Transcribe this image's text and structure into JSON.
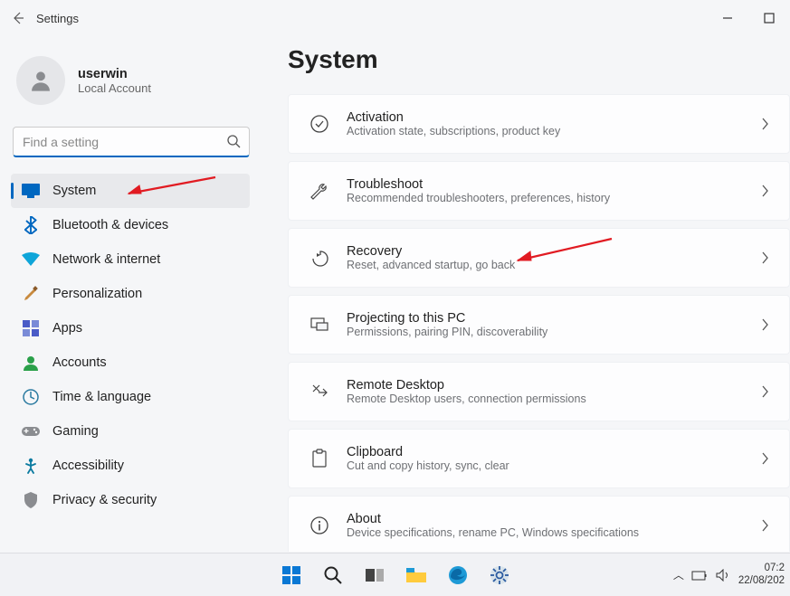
{
  "titlebar": {
    "title": "Settings"
  },
  "account": {
    "name": "userwin",
    "sub": "Local Account"
  },
  "search": {
    "placeholder": "Find a setting"
  },
  "sidebar": {
    "items": [
      {
        "label": "System"
      },
      {
        "label": "Bluetooth & devices"
      },
      {
        "label": "Network & internet"
      },
      {
        "label": "Personalization"
      },
      {
        "label": "Apps"
      },
      {
        "label": "Accounts"
      },
      {
        "label": "Time & language"
      },
      {
        "label": "Gaming"
      },
      {
        "label": "Accessibility"
      },
      {
        "label": "Privacy & security"
      }
    ]
  },
  "content": {
    "heading": "System",
    "cards": [
      {
        "title": "Activation",
        "sub": "Activation state, subscriptions, product key"
      },
      {
        "title": "Troubleshoot",
        "sub": "Recommended troubleshooters, preferences, history"
      },
      {
        "title": "Recovery",
        "sub": "Reset, advanced startup, go back"
      },
      {
        "title": "Projecting to this PC",
        "sub": "Permissions, pairing PIN, discoverability"
      },
      {
        "title": "Remote Desktop",
        "sub": "Remote Desktop users, connection permissions"
      },
      {
        "title": "Clipboard",
        "sub": "Cut and copy history, sync, clear"
      },
      {
        "title": "About",
        "sub": "Device specifications, rename PC, Windows specifications"
      }
    ]
  },
  "taskbar": {
    "time": "07:2",
    "date": "22/08/202"
  }
}
